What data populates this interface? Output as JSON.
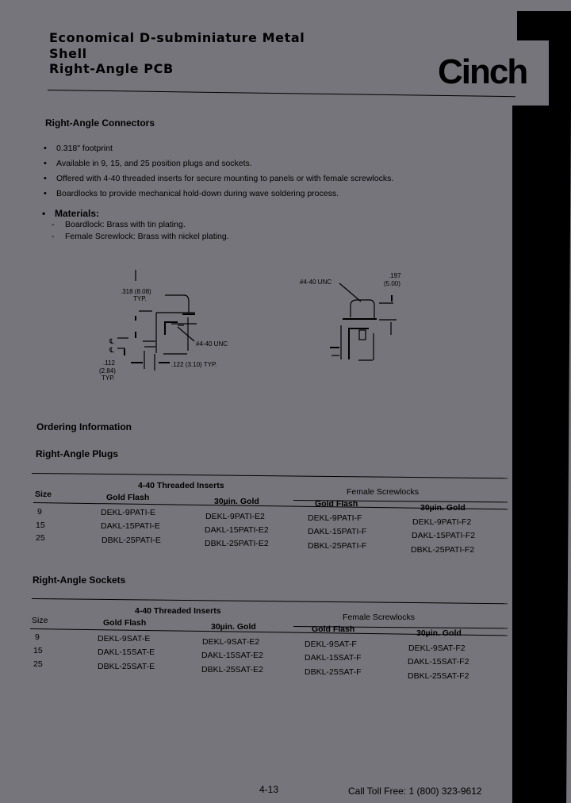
{
  "header": {
    "title_lines": [
      "Economical D-subminiature Metal",
      "Shell",
      "Right-Angle PCB"
    ],
    "brand": "Cinch"
  },
  "connectors": {
    "heading": "Right-Angle Connectors",
    "bullets": [
      "0.318\" footprint",
      "Available in 9, 15, and 25 position plugs and sockets.",
      "Offered with 4-40 threaded inserts for secure mounting to panels or with female screwlocks.",
      "Boardlocks to provide mechanical hold-down during wave soldering process."
    ],
    "materials": {
      "heading": "Materials:",
      "items": [
        "Boardlock:  Brass with tin plating.",
        "Female Screwlock:  Brass with nickel plating."
      ]
    }
  },
  "drawings": {
    "left": {
      "dim_top": ".318  (8.08)",
      "dim_top_typ": "TYP.",
      "dim_thread": "#4-40 UNC",
      "dim_pitch": ".112",
      "dim_pitch_mm": "(2.84)",
      "dim_pitch_typ": "TYP.",
      "dim_right": ".122  (3.10)  TYP.",
      "centerline_label": "℄"
    },
    "right": {
      "dim_thread": "#4-40 UNC",
      "dim_height": ".197",
      "dim_height_mm": "(5.00)"
    }
  },
  "ordering": {
    "heading": "Ordering Information",
    "plugs": {
      "heading": "Right-Angle Plugs",
      "group_threaded": "4-40 Threaded Inserts",
      "group_screwlocks": "Female Screwlocks",
      "col_size": "Size",
      "col_gold_flash": "Gold Flash",
      "col_30u_gold": "30µin. Gold",
      "rows": [
        {
          "size": "9",
          "threaded_flash": "DEKL-9PATI-E",
          "threaded_gold": "DEKL-9PATI-E2",
          "screw_flash": "DEKL-9PATI-F",
          "screw_gold": "DEKL-9PATI-F2"
        },
        {
          "size": "15",
          "threaded_flash": "DAKL-15PATI-E",
          "threaded_gold": "DAKL-15PATI-E2",
          "screw_flash": "DAKL-15PATI-F",
          "screw_gold": "DAKL-15PATI-F2"
        },
        {
          "size": "25",
          "threaded_flash": "DBKL-25PATI-E",
          "threaded_gold": "DBKL-25PATI-E2",
          "screw_flash": "DBKL-25PATI-F",
          "screw_gold": "DBKL-25PATI-F2"
        }
      ]
    },
    "sockets": {
      "heading": "Right-Angle Sockets",
      "group_threaded": "4-40 Threaded Inserts",
      "group_screwlocks": "Female Screwlocks",
      "col_size": "Size",
      "col_gold_flash": "Gold Flash",
      "col_30u_gold": "30µin. Gold",
      "rows": [
        {
          "size": "9",
          "threaded_flash": "DEKL-9SAT-E",
          "threaded_gold": "DEKL-9SAT-E2",
          "screw_flash": "DEKL-9SAT-F",
          "screw_gold": "DEKL-9SAT-F2"
        },
        {
          "size": "15",
          "threaded_flash": "DAKL-15SAT-E",
          "threaded_gold": "DAKL-15SAT-E2",
          "screw_flash": "DAKL-15SAT-F",
          "screw_gold": "DAKL-15SAT-F2"
        },
        {
          "size": "25",
          "threaded_flash": "DBKL-25SAT-E",
          "threaded_gold": "DBKL-25SAT-E2",
          "screw_flash": "DBKL-25SAT-F",
          "screw_gold": "DBKL-25SAT-F2"
        }
      ]
    }
  },
  "footer": {
    "page_number": "4-13",
    "toll_free": "Call Toll Free:  1 (800) 323-9612"
  }
}
